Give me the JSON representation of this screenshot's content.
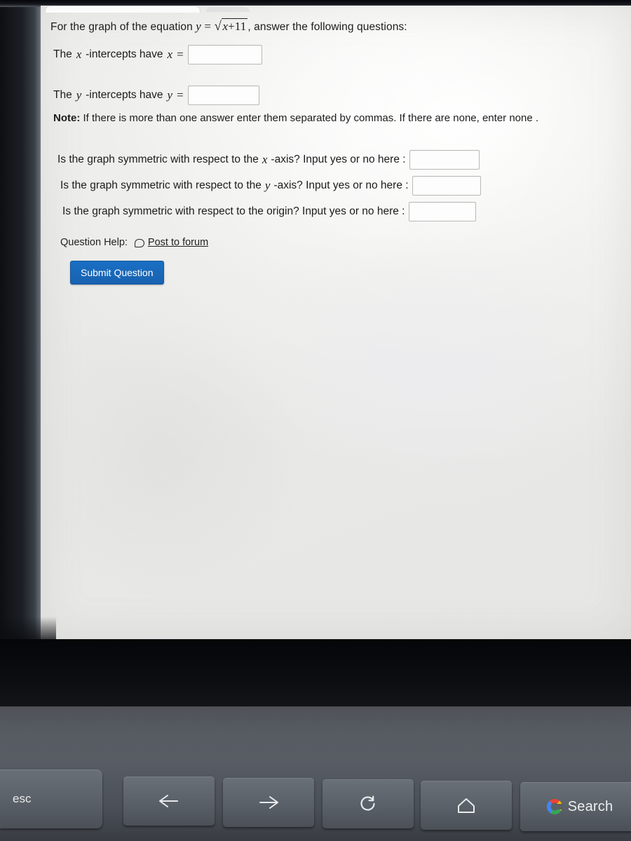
{
  "page": {
    "question_intro_prefix": "For the graph of the equation",
    "equation": {
      "lhs": "y",
      "equals": "=",
      "radicand_var": "x",
      "radicand_plus": "+",
      "radicand_const": "11"
    },
    "question_intro_suffix": ", answer the following questions:",
    "x_intercept_label_prefix": "The",
    "x_intercept_label_var": "x",
    "x_intercept_label_mid": "-intercepts have",
    "x_intercept_label_var2": "x",
    "x_intercept_label_equals": "=",
    "x_intercept_value": "",
    "x_intercept_placeholder": "",
    "y_intercept_label_prefix": "The",
    "y_intercept_label_var": "y",
    "y_intercept_label_mid": "-intercepts have",
    "y_intercept_label_var2": "y",
    "y_intercept_label_equals": "=",
    "y_intercept_value": "",
    "y_intercept_placeholder": "",
    "note_bold": "Note:",
    "note_text": "If there is more than one answer enter them separated by commas. If there are none, enter none .",
    "symmetry": [
      {
        "prefix": "Is the graph symmetric with respect to the",
        "axis": "x",
        "suffix": "-axis? Input yes or no here :",
        "value": ""
      },
      {
        "prefix": "Is the graph symmetric with respect to the",
        "axis": "y",
        "suffix": "-axis? Input yes or no here :",
        "value": ""
      },
      {
        "prefix": "Is the graph symmetric with respect to the origin? Input yes or no here :",
        "axis": "",
        "suffix": "",
        "value": ""
      }
    ],
    "question_help_label": "Question Help:",
    "post_to_forum": "Post to forum",
    "submit_button": "Submit Question"
  },
  "keyboard": {
    "esc": "esc",
    "back": "",
    "forward": "",
    "reload": "",
    "home": "",
    "search_label": "Search",
    "search_icon": "google-g-icon"
  },
  "colors": {
    "submit_button_bg": "#1a6fc4",
    "submit_button_text": "#ffffff",
    "page_bg": "#f3f3f1",
    "text": "#1c1c1c",
    "keyboard_key": "#5a6067",
    "google_blue": "#4285f4",
    "google_red": "#ea4335",
    "google_yellow": "#fbbc05",
    "google_green": "#34a853"
  }
}
